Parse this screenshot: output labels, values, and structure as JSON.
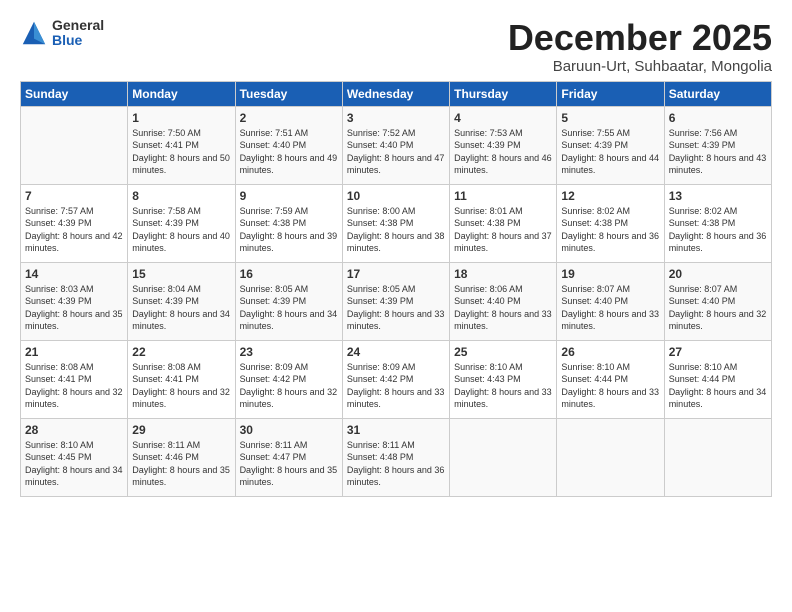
{
  "logo": {
    "general": "General",
    "blue": "Blue"
  },
  "title": "December 2025",
  "location": "Baruun-Urt, Suhbaatar, Mongolia",
  "headers": [
    "Sunday",
    "Monday",
    "Tuesday",
    "Wednesday",
    "Thursday",
    "Friday",
    "Saturday"
  ],
  "weeks": [
    [
      {
        "day": "",
        "info": ""
      },
      {
        "day": "1",
        "info": "Sunrise: 7:50 AM\nSunset: 4:41 PM\nDaylight: 8 hours\nand 50 minutes."
      },
      {
        "day": "2",
        "info": "Sunrise: 7:51 AM\nSunset: 4:40 PM\nDaylight: 8 hours\nand 49 minutes."
      },
      {
        "day": "3",
        "info": "Sunrise: 7:52 AM\nSunset: 4:40 PM\nDaylight: 8 hours\nand 47 minutes."
      },
      {
        "day": "4",
        "info": "Sunrise: 7:53 AM\nSunset: 4:39 PM\nDaylight: 8 hours\nand 46 minutes."
      },
      {
        "day": "5",
        "info": "Sunrise: 7:55 AM\nSunset: 4:39 PM\nDaylight: 8 hours\nand 44 minutes."
      },
      {
        "day": "6",
        "info": "Sunrise: 7:56 AM\nSunset: 4:39 PM\nDaylight: 8 hours\nand 43 minutes."
      }
    ],
    [
      {
        "day": "7",
        "info": "Sunrise: 7:57 AM\nSunset: 4:39 PM\nDaylight: 8 hours\nand 42 minutes."
      },
      {
        "day": "8",
        "info": "Sunrise: 7:58 AM\nSunset: 4:39 PM\nDaylight: 8 hours\nand 40 minutes."
      },
      {
        "day": "9",
        "info": "Sunrise: 7:59 AM\nSunset: 4:38 PM\nDaylight: 8 hours\nand 39 minutes."
      },
      {
        "day": "10",
        "info": "Sunrise: 8:00 AM\nSunset: 4:38 PM\nDaylight: 8 hours\nand 38 minutes."
      },
      {
        "day": "11",
        "info": "Sunrise: 8:01 AM\nSunset: 4:38 PM\nDaylight: 8 hours\nand 37 minutes."
      },
      {
        "day": "12",
        "info": "Sunrise: 8:02 AM\nSunset: 4:38 PM\nDaylight: 8 hours\nand 36 minutes."
      },
      {
        "day": "13",
        "info": "Sunrise: 8:02 AM\nSunset: 4:38 PM\nDaylight: 8 hours\nand 36 minutes."
      }
    ],
    [
      {
        "day": "14",
        "info": "Sunrise: 8:03 AM\nSunset: 4:39 PM\nDaylight: 8 hours\nand 35 minutes."
      },
      {
        "day": "15",
        "info": "Sunrise: 8:04 AM\nSunset: 4:39 PM\nDaylight: 8 hours\nand 34 minutes."
      },
      {
        "day": "16",
        "info": "Sunrise: 8:05 AM\nSunset: 4:39 PM\nDaylight: 8 hours\nand 34 minutes."
      },
      {
        "day": "17",
        "info": "Sunrise: 8:05 AM\nSunset: 4:39 PM\nDaylight: 8 hours\nand 33 minutes."
      },
      {
        "day": "18",
        "info": "Sunrise: 8:06 AM\nSunset: 4:40 PM\nDaylight: 8 hours\nand 33 minutes."
      },
      {
        "day": "19",
        "info": "Sunrise: 8:07 AM\nSunset: 4:40 PM\nDaylight: 8 hours\nand 33 minutes."
      },
      {
        "day": "20",
        "info": "Sunrise: 8:07 AM\nSunset: 4:40 PM\nDaylight: 8 hours\nand 32 minutes."
      }
    ],
    [
      {
        "day": "21",
        "info": "Sunrise: 8:08 AM\nSunset: 4:41 PM\nDaylight: 8 hours\nand 32 minutes."
      },
      {
        "day": "22",
        "info": "Sunrise: 8:08 AM\nSunset: 4:41 PM\nDaylight: 8 hours\nand 32 minutes."
      },
      {
        "day": "23",
        "info": "Sunrise: 8:09 AM\nSunset: 4:42 PM\nDaylight: 8 hours\nand 32 minutes."
      },
      {
        "day": "24",
        "info": "Sunrise: 8:09 AM\nSunset: 4:42 PM\nDaylight: 8 hours\nand 33 minutes."
      },
      {
        "day": "25",
        "info": "Sunrise: 8:10 AM\nSunset: 4:43 PM\nDaylight: 8 hours\nand 33 minutes."
      },
      {
        "day": "26",
        "info": "Sunrise: 8:10 AM\nSunset: 4:44 PM\nDaylight: 8 hours\nand 33 minutes."
      },
      {
        "day": "27",
        "info": "Sunrise: 8:10 AM\nSunset: 4:44 PM\nDaylight: 8 hours\nand 34 minutes."
      }
    ],
    [
      {
        "day": "28",
        "info": "Sunrise: 8:10 AM\nSunset: 4:45 PM\nDaylight: 8 hours\nand 34 minutes."
      },
      {
        "day": "29",
        "info": "Sunrise: 8:11 AM\nSunset: 4:46 PM\nDaylight: 8 hours\nand 35 minutes."
      },
      {
        "day": "30",
        "info": "Sunrise: 8:11 AM\nSunset: 4:47 PM\nDaylight: 8 hours\nand 35 minutes."
      },
      {
        "day": "31",
        "info": "Sunrise: 8:11 AM\nSunset: 4:48 PM\nDaylight: 8 hours\nand 36 minutes."
      },
      {
        "day": "",
        "info": ""
      },
      {
        "day": "",
        "info": ""
      },
      {
        "day": "",
        "info": ""
      }
    ]
  ]
}
